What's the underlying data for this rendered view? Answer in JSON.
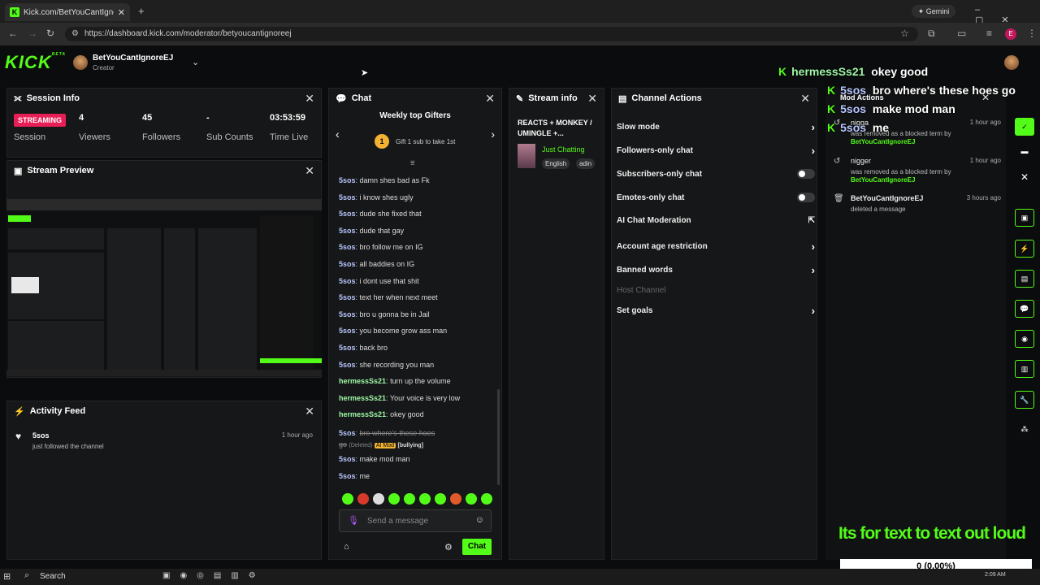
{
  "browser": {
    "tab_title": "Kick.com/BetYouCantIgnoreEJ Stream - Kick",
    "gemini": "Gemini",
    "url": "https://dashboard.kick.com/moderator/betyoucantignoreej",
    "profile": "E"
  },
  "app": {
    "logo": "KICK",
    "logo_sup": "BETA",
    "channel_name": "BetYouCantIgnoreEJ",
    "channel_role": "Creator"
  },
  "session": {
    "title": "Session Info",
    "badge": "STREAMING",
    "badge_sub": "Session",
    "viewers": "4",
    "viewers_label": "Viewers",
    "followers": "45",
    "followers_label": "Followers",
    "subs": "-",
    "subs_label": "Sub Counts",
    "time": "03:53:59",
    "time_label": "Time Live"
  },
  "preview": {
    "title": "Stream Preview"
  },
  "activity": {
    "title": "Activity Feed",
    "items": [
      {
        "user": "5sos",
        "text": "just followed the channel",
        "time": "1 hour ago"
      }
    ]
  },
  "chat": {
    "title": "Chat",
    "gifters_title": "Weekly top Gifters",
    "gift_rank": "1",
    "gift_text": "Gift 1 sub to take 1st",
    "messages": [
      {
        "user": "5sos",
        "text": "damn shes bad as Fk"
      },
      {
        "user": "5sos",
        "text": "i know shes ugly"
      },
      {
        "user": "5sos",
        "text": "dude she fixed that"
      },
      {
        "user": "5sos",
        "text": "dude that gay"
      },
      {
        "user": "5sos",
        "text": "bro follow me on IG"
      },
      {
        "user": "5sos",
        "text": "all baddies on IG"
      },
      {
        "user": "5sos",
        "text": "i dont use that shit"
      },
      {
        "user": "5sos",
        "text": "text her when next meet"
      },
      {
        "user": "5sos",
        "text": "bro u gonna be in Jail"
      },
      {
        "user": "5sos",
        "text": "you become grow ass man"
      },
      {
        "user": "5sos",
        "text": "back bro"
      },
      {
        "user": "5sos",
        "text": "she recording you man"
      },
      {
        "user": "hermessSs21",
        "text": "turn up the volume"
      },
      {
        "user": "hermessSs21",
        "text": "Your voice is very low"
      },
      {
        "user": "hermessSs21",
        "text": "okey good"
      }
    ],
    "deleted": {
      "user": "5sos",
      "text1": "bro where's these hoes",
      "text2": "go",
      "deleted_label": "(Deleted)",
      "mod_label": "AI Mod",
      "reason": "[bullying]"
    },
    "after": [
      {
        "user": "5sos",
        "text": "make mod man"
      },
      {
        "user": "5sos",
        "text": "me"
      }
    ],
    "input_placeholder": "Send a message",
    "send_label": "Chat"
  },
  "stream_info": {
    "title": "Stream info",
    "stream_title": "REACTS + MONKEY / UMINGLE +...",
    "category": "Just Chatting",
    "tag1": "English",
    "tag2": "adin"
  },
  "channel_actions": {
    "title": "Channel Actions",
    "items": [
      "Slow mode",
      "Followers-only chat",
      "Subscribers-only chat",
      "Emotes-only chat",
      "AI Chat Moderation",
      "Account age restriction",
      "Banned words",
      "Host Channel",
      "Set goals"
    ]
  },
  "mod_actions": {
    "title": "Mod Actions",
    "items": [
      {
        "term": "nigga",
        "desc": "was removed as a blocked term by",
        "by": "BetYouCantIgnoreEJ",
        "time": "1 hour ago"
      },
      {
        "term": "nigger",
        "desc": "was removed as a blocked term by",
        "by": "BetYouCantIgnoreEJ",
        "time": "1 hour ago"
      },
      {
        "term": "BetYouCantIgnoreEJ",
        "desc": "deleted a message",
        "by": "",
        "time": "3 hours ago"
      }
    ]
  },
  "overlay": {
    "lines": [
      {
        "user": "hermessSs21",
        "text": "okey good"
      },
      {
        "user": "5sos",
        "text": "bro where's these hoes go"
      },
      {
        "user": "5sos",
        "text": "make mod man"
      },
      {
        "user": "5sos",
        "text": "me"
      }
    ],
    "big_text": "Its for text to text out loud",
    "counter": "0 (0.00%)"
  },
  "taskbar": {
    "search": "Search",
    "time": "2:09 AM"
  }
}
